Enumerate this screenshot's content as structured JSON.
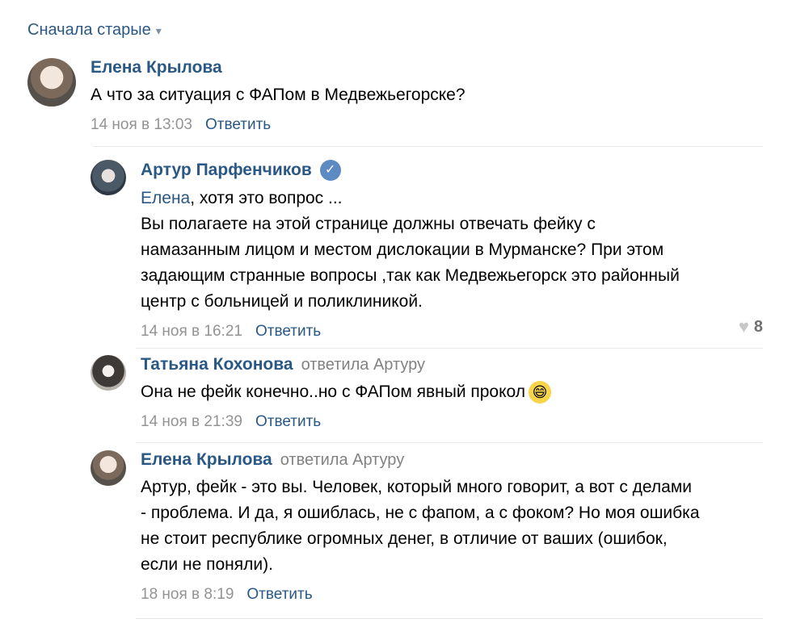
{
  "sort": {
    "label": "Сначала старые",
    "icon": "chevron-down-icon"
  },
  "comments": [
    {
      "author": "Елена Крылова",
      "text": "А что за ситуация с ФАПом в Медвежьегорске?",
      "date": "14 ноя в 13:03",
      "reply_label": "Ответить"
    },
    {
      "author": "Артур Парфенчиков",
      "verified_icon": "verified-badge-icon",
      "mention": "Елена",
      "text": ", хотя это вопрос ...\nВы полагаете на этой странице должны отвечать фейку с\nнамазанным лицом и местом дислокации в Мурманске? При этом\nзадающим странные вопросы ,так как Медвежьегорск это районный\nцентр с больницей и поликлиникой.",
      "date": "14 ноя в 16:21",
      "reply_label": "Ответить",
      "likes": "8"
    },
    {
      "author": "Татьяна Кохонова",
      "replied": "ответила Артуру",
      "text": "Она не фейк конечно..но с ФАПом явный прокол",
      "emoji": "😄",
      "date": "14 ноя в 21:39",
      "reply_label": "Ответить"
    },
    {
      "author": "Елена Крылова",
      "replied": "ответила Артуру",
      "text": "Артур, фейк - это вы. Человек, который много говорит, а вот с делами\n- проблема. И да, я ошиблась, не с фапом, а с фоком? Но моя ошибка\nне стоит республике огромных денег, в отличие от ваших (ошибок,\nесли не поняли).",
      "date": "18 ноя в 8:19",
      "reply_label": "Ответить"
    }
  ]
}
